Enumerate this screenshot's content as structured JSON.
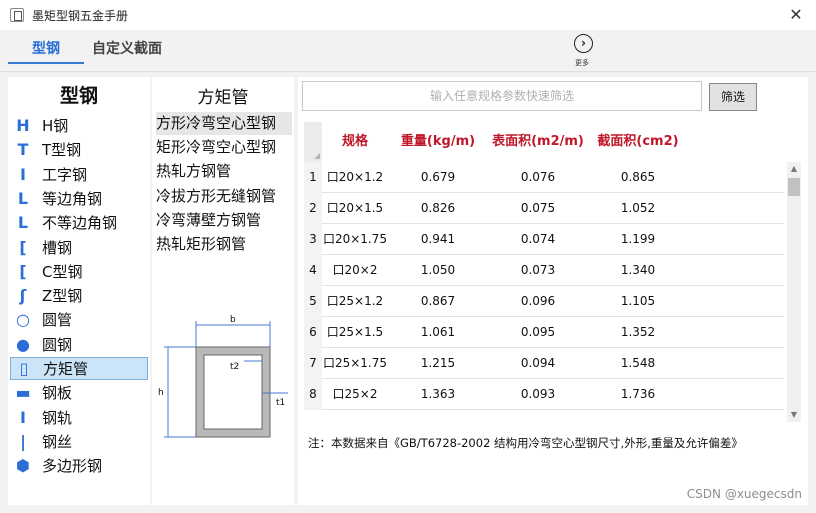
{
  "window": {
    "title": "墨矩型钢五金手册",
    "close_glyph": "✕"
  },
  "tabs": [
    {
      "label": "型钢",
      "active": true
    },
    {
      "label": "自定义截面",
      "active": false
    }
  ],
  "more": {
    "label": "更多",
    "icon": "chevron-right-circle-icon",
    "glyph": "›"
  },
  "accent_color": "#2b6fd6",
  "header_text_color": "#c0182a",
  "left_panel": {
    "header": "型钢",
    "items": [
      {
        "label": "H钢",
        "icon": "h-beam-icon",
        "glyph": "H"
      },
      {
        "label": "T型钢",
        "icon": "t-beam-icon",
        "glyph": "T"
      },
      {
        "label": "工字钢",
        "icon": "i-beam-icon",
        "glyph": "I"
      },
      {
        "label": "等边角钢",
        "icon": "equal-angle-icon",
        "glyph": "L"
      },
      {
        "label": "不等边角钢",
        "icon": "unequal-angle-icon",
        "glyph": "L"
      },
      {
        "label": "槽钢",
        "icon": "channel-icon",
        "glyph": "["
      },
      {
        "label": "C型钢",
        "icon": "c-channel-icon",
        "glyph": "["
      },
      {
        "label": "Z型钢",
        "icon": "z-channel-icon",
        "glyph": "ʃ"
      },
      {
        "label": "圆管",
        "icon": "round-tube-icon",
        "glyph": "○"
      },
      {
        "label": "圆钢",
        "icon": "round-bar-icon",
        "glyph": "●"
      },
      {
        "label": "方矩管",
        "icon": "rect-tube-icon",
        "glyph": "▯",
        "selected": true
      },
      {
        "label": "钢板",
        "icon": "plate-icon",
        "glyph": "▬"
      },
      {
        "label": "钢轨",
        "icon": "rail-icon",
        "glyph": "I"
      },
      {
        "label": "钢丝",
        "icon": "wire-icon",
        "glyph": "|"
      },
      {
        "label": "多边形钢",
        "icon": "hexagon-icon",
        "glyph": "⬢"
      }
    ]
  },
  "mid_panel": {
    "header": "方矩管",
    "items": [
      {
        "label": "方形冷弯空心型钢",
        "selected": true
      },
      {
        "label": "矩形冷弯空心型钢"
      },
      {
        "label": "热轧方钢管"
      },
      {
        "label": "冷拔方形无缝钢管"
      },
      {
        "label": "冷弯薄壁方钢管"
      },
      {
        "label": "热轧矩形钢管"
      }
    ],
    "diagram_labels": {
      "b": "b",
      "h": "h",
      "t1": "t1",
      "t2": "t2"
    }
  },
  "search": {
    "placeholder": "输入任意规格参数快速筛选",
    "value": ""
  },
  "filter_button": "筛选",
  "table": {
    "columns": [
      "规格",
      "重量(kg/m)",
      "表面积(m2/m)",
      "截面积(cm2)"
    ],
    "rows": [
      [
        "1",
        "口20×1.2",
        "0.679",
        "0.076",
        "0.865"
      ],
      [
        "2",
        "口20×1.5",
        "0.826",
        "0.075",
        "1.052"
      ],
      [
        "3",
        "口20×1.75",
        "0.941",
        "0.074",
        "1.199"
      ],
      [
        "4",
        "口20×2",
        "1.050",
        "0.073",
        "1.340"
      ],
      [
        "5",
        "口25×1.2",
        "0.867",
        "0.096",
        "1.105"
      ],
      [
        "6",
        "口25×1.5",
        "1.061",
        "0.095",
        "1.352"
      ],
      [
        "7",
        "口25×1.75",
        "1.215",
        "0.094",
        "1.548"
      ],
      [
        "8",
        "口25×2",
        "1.363",
        "0.093",
        "1.736"
      ]
    ]
  },
  "note": "注：本数据来自《GB/T6728-2002 结构用冷弯空心型钢尺寸,外形,重量及允许偏差》",
  "watermark": "CSDN @xuegecsdn"
}
